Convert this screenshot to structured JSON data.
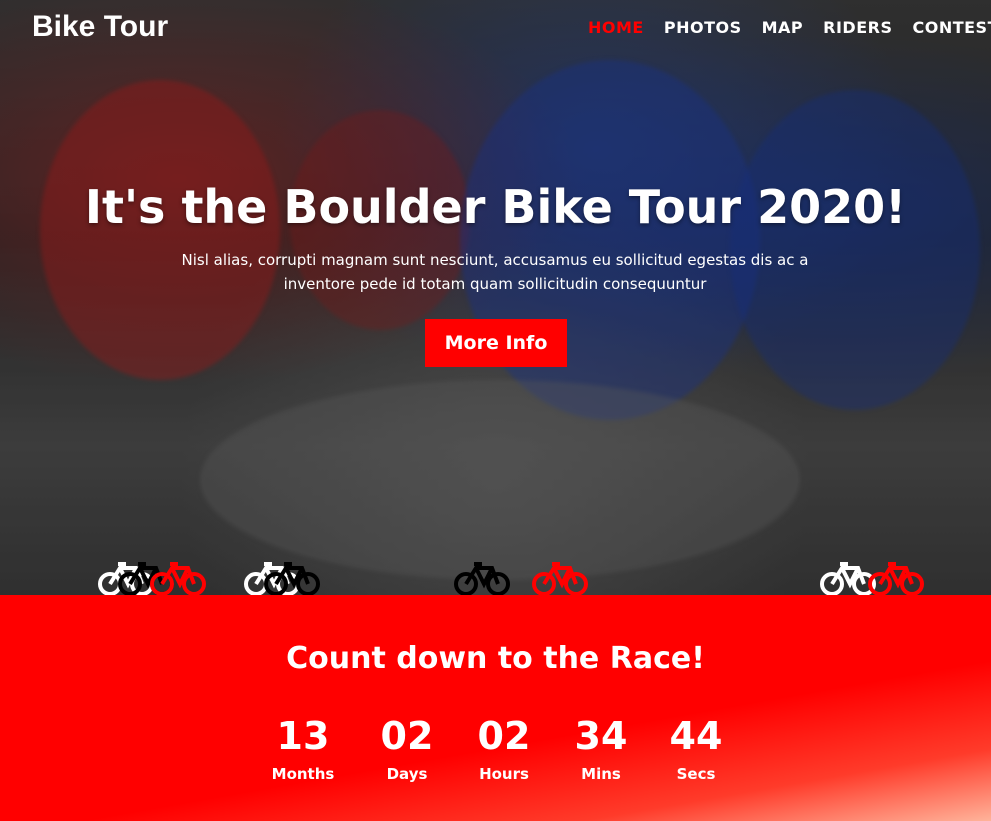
{
  "header": {
    "brand": "Bike Tour",
    "nav": [
      "HOME",
      "PHOTOS",
      "MAP",
      "RIDERS",
      "CONTEST"
    ],
    "active_index": 0
  },
  "hero": {
    "headline": "It's the Boulder Bike Tour 2020!",
    "subtext": "Nisl alias, corrupti magnam sunt nesciunt, accusamus eu sollicitud egestas dis ac a inventore pede id totam quam sollicitudin consequuntur",
    "cta_label": "More Info"
  },
  "countdown": {
    "title": "Count down to the Race!",
    "items": [
      {
        "value": "13",
        "label": "Months"
      },
      {
        "value": "02",
        "label": "Days"
      },
      {
        "value": "02",
        "label": "Hours"
      },
      {
        "value": "34",
        "label": "Mins"
      },
      {
        "value": "44",
        "label": "Secs"
      }
    ]
  },
  "colors": {
    "accent": "#ff0000",
    "text": "#ffffff"
  },
  "icons": {
    "bike": "bicycle-icon"
  }
}
